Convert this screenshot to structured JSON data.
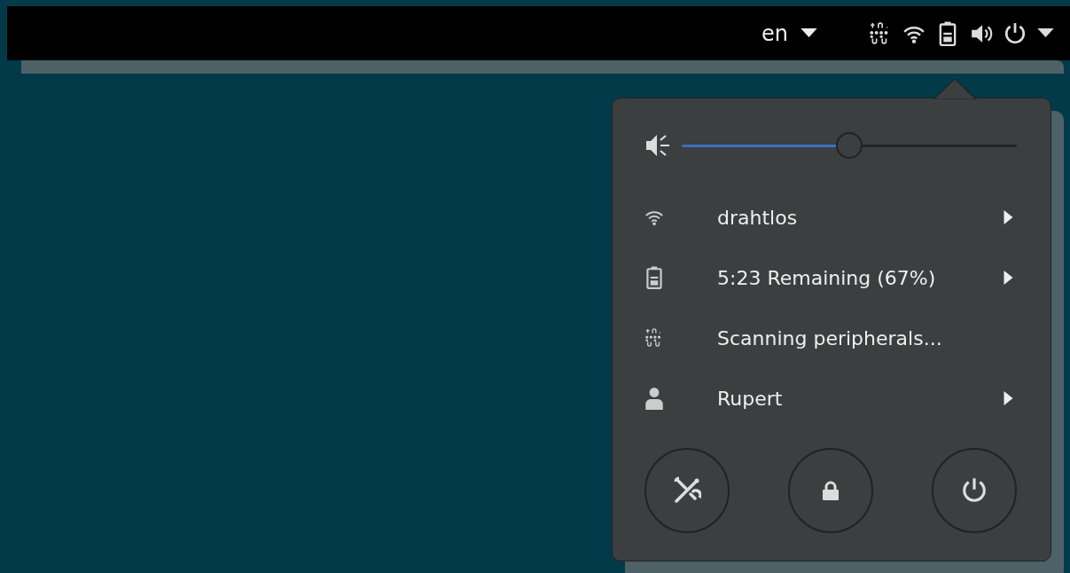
{
  "top_bar": {
    "language": "en"
  },
  "volume": {
    "level": 0.5
  },
  "menu_items": [
    {
      "kind": "wifi",
      "label": "drahtlos",
      "arrow": true
    },
    {
      "kind": "battery",
      "label": "5:23 Remaining (67%)",
      "arrow": true
    },
    {
      "kind": "peripherals",
      "label": "Scanning peripherals...",
      "arrow": false
    },
    {
      "kind": "user",
      "label": "Rupert",
      "arrow": true
    }
  ],
  "buttons": [
    {
      "kind": "settings"
    },
    {
      "kind": "lock"
    },
    {
      "kind": "power"
    }
  ]
}
